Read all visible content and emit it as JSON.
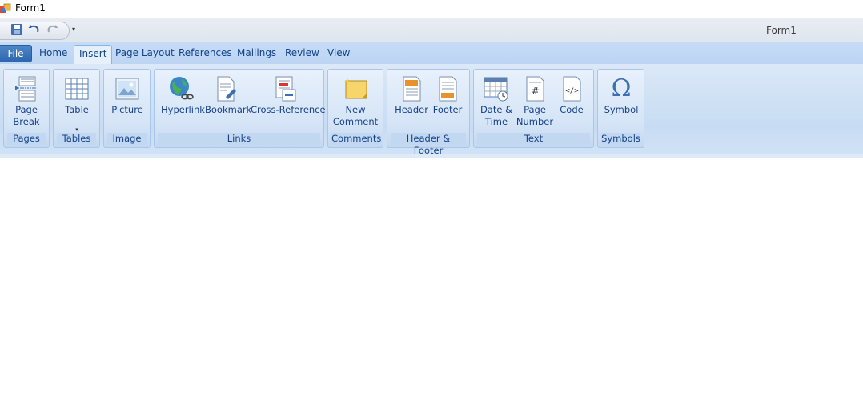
{
  "window": {
    "title": "Form1"
  },
  "qat": {
    "dropdown_glyph": "▾"
  },
  "ribbon": {
    "title": "Form1",
    "tabs": [
      {
        "label": "File"
      },
      {
        "label": "Home"
      },
      {
        "label": "Insert"
      },
      {
        "label": "Page Layout"
      },
      {
        "label": "References"
      },
      {
        "label": "Mailings"
      },
      {
        "label": "Review"
      },
      {
        "label": "View"
      }
    ],
    "active_tab": "Insert",
    "groups": {
      "pages": {
        "label": "Pages",
        "page_break": {
          "line1": "Page",
          "line2": "Break",
          "icon": "page-break-icon"
        }
      },
      "tables": {
        "label": "Tables",
        "table": {
          "line1": "Table",
          "arrow": "▾",
          "icon": "table-icon"
        }
      },
      "image": {
        "label": "Image",
        "picture": {
          "line1": "Picture",
          "icon": "picture-icon"
        }
      },
      "links": {
        "label": "Links",
        "hyperlink": {
          "line1": "Hyperlink",
          "icon": "globe-link-icon"
        },
        "bookmark": {
          "line1": "Bookmark",
          "icon": "bookmark-icon"
        },
        "cross_reference": {
          "line1": "Cross-Reference",
          "icon": "cross-reference-icon"
        }
      },
      "comments": {
        "label": "Comments",
        "new_comment": {
          "line1": "New",
          "line2": "Comment",
          "icon": "comment-icon"
        }
      },
      "header_footer": {
        "label": "Header & Footer",
        "header": {
          "line1": "Header",
          "icon": "header-icon"
        },
        "footer": {
          "line1": "Footer",
          "icon": "footer-icon"
        }
      },
      "text": {
        "label": "Text",
        "date_time": {
          "line1": "Date &",
          "line2": "Time",
          "icon": "date-time-icon"
        },
        "page_number": {
          "line1": "Page",
          "line2": "Number",
          "icon": "page-number-icon"
        },
        "code": {
          "line1": "Code",
          "icon": "code-icon"
        }
      },
      "symbols": {
        "label": "Symbols",
        "symbol": {
          "line1": "Symbol",
          "glyph": "Ω",
          "icon": "omega-icon"
        }
      }
    }
  },
  "colors": {
    "accent": "#15428b",
    "tab_bar": "#c5dcf6",
    "file_tab": "#2d67b0"
  }
}
